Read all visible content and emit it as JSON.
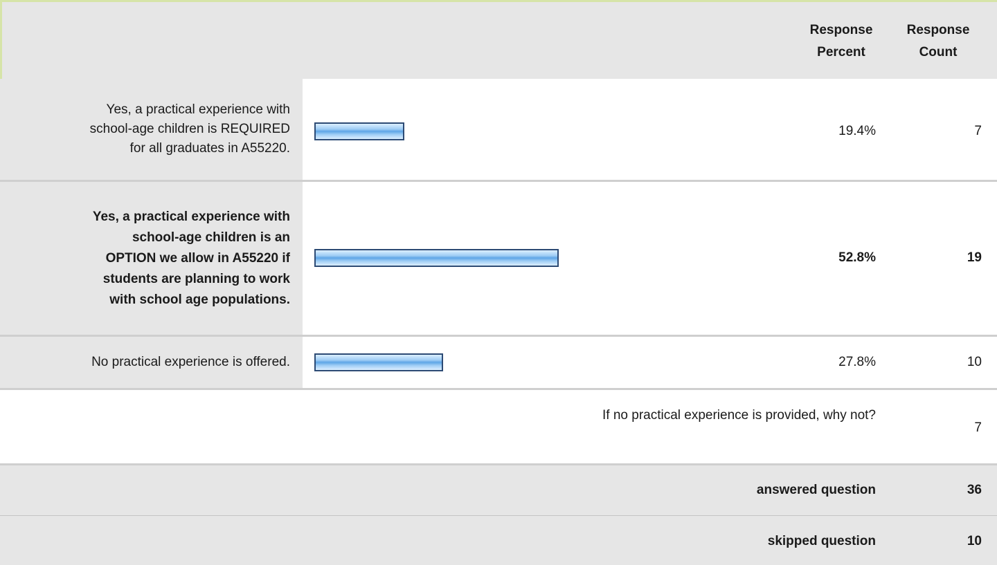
{
  "header": {
    "response_percent_line1": "Response",
    "response_percent_line2": "Percent",
    "response_count_line1": "Response",
    "response_count_line2": "Count"
  },
  "chart_data": {
    "type": "bar",
    "categories": [
      "Yes, a practical experience with school-age children is REQUIRED for all graduates in A55220.",
      "Yes, a practical experience with school-age children is an OPTION we allow in A55220 if students are planning to work with school age populations.",
      "No practical experience is offered."
    ],
    "values": [
      19.4,
      52.8,
      27.8
    ],
    "counts": [
      7,
      19,
      10
    ],
    "value_labels": [
      "19.4%",
      "52.8%",
      "27.8%"
    ],
    "count_labels": [
      "7",
      "19",
      "10"
    ],
    "bold_row": 1,
    "bar_color": "#5ea5e6",
    "bar_border_color": "#2c4a74"
  },
  "rows": [
    {
      "label_lines": [
        "Yes, a practical experience with",
        "school-age children is REQUIRED",
        "for all graduates in A55220."
      ],
      "percent": "19.4%",
      "count": "7"
    },
    {
      "label_lines": [
        "Yes, a practical experience with",
        "school-age children is an",
        "OPTION we allow in A55220 if",
        "students are planning to work",
        "with school age populations."
      ],
      "percent": "52.8%",
      "count": "19"
    },
    {
      "label_lines": [
        "No practical experience is offered."
      ],
      "percent": "27.8%",
      "count": "10"
    }
  ],
  "open_ended": {
    "question": "If no practical experience is provided, why not?",
    "count": "7"
  },
  "summary": {
    "answered_label": "answered question",
    "answered_count": "36",
    "skipped_label": "skipped question",
    "skipped_count": "10"
  }
}
